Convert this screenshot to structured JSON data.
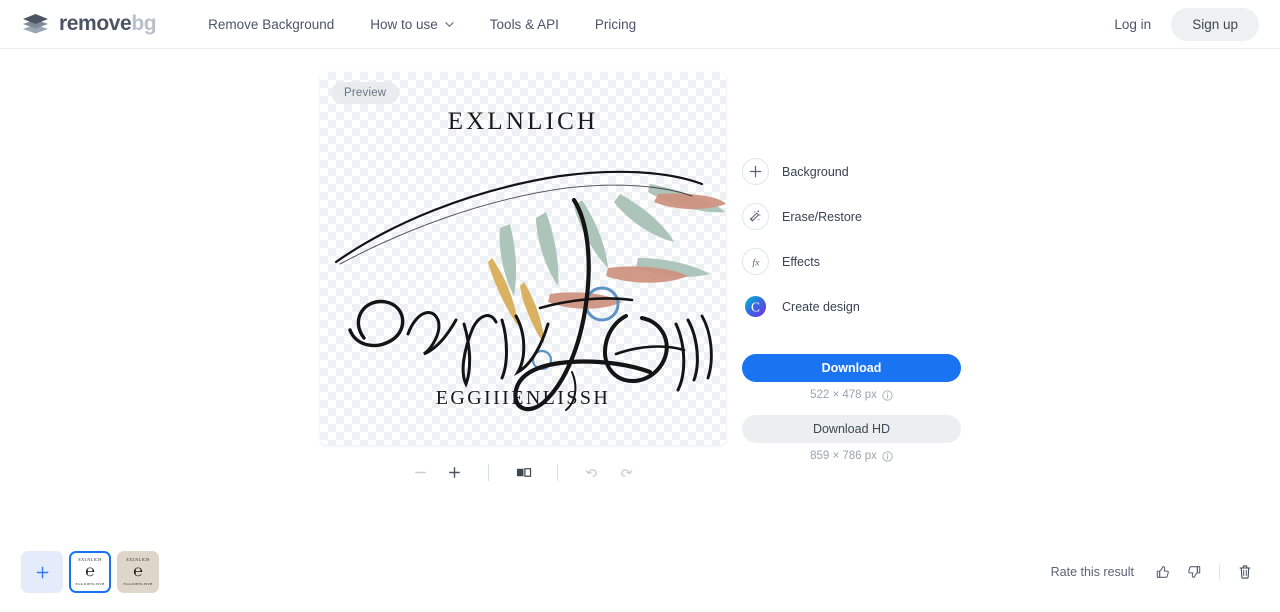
{
  "header": {
    "logo": {
      "icon": "layers-diamond-icon",
      "text_primary": "remove",
      "text_secondary": "bg"
    },
    "nav": [
      {
        "label": "Remove Background",
        "name": "nav-remove-background",
        "chevron": false
      },
      {
        "label": "How to use",
        "name": "nav-how-to-use",
        "chevron": true
      },
      {
        "label": "Tools & API",
        "name": "nav-tools-api",
        "chevron": false
      },
      {
        "label": "Pricing",
        "name": "nav-pricing",
        "chevron": false
      }
    ],
    "login_label": "Log in",
    "signup_label": "Sign up"
  },
  "canvas": {
    "preview_badge": "Preview",
    "artwork": {
      "title_text": "EXLNLICH",
      "subtitle_text": "EGGIIIENLISSH",
      "description": "ornate calligraphic script logo with botanical leaf flourishes",
      "colors": {
        "ink": "#1a1a1a",
        "leaf_sage": "#9db9ae",
        "leaf_terracotta": "#c98b75",
        "leaf_gold": "#d6a94e",
        "accent_blue": "#3e7fbf"
      }
    }
  },
  "toolbar": {
    "zoom_out": {
      "label": "−",
      "name": "zoom-out-button",
      "disabled": true
    },
    "zoom_in": {
      "label": "+",
      "name": "zoom-in-button",
      "disabled": false
    },
    "compare": {
      "name": "compare-split-toggle",
      "disabled": false
    },
    "undo": {
      "name": "undo-button",
      "disabled": true
    },
    "redo": {
      "name": "redo-button",
      "disabled": true
    }
  },
  "panel": {
    "tools": [
      {
        "label": "Background",
        "icon": "plus-icon",
        "name": "tool-background"
      },
      {
        "label": "Erase/Restore",
        "icon": "magic-brush-icon",
        "name": "tool-erase-restore"
      },
      {
        "label": "Effects",
        "icon": "fx-icon",
        "name": "tool-effects"
      },
      {
        "label": "Create design",
        "icon": "canva-logo-icon",
        "name": "tool-create-design"
      }
    ],
    "download": {
      "primary_label": "Download",
      "primary_size": "522 × 478 px",
      "secondary_label": "Download HD",
      "secondary_size": "859 × 786 px",
      "info_icon": "info-circle-icon"
    }
  },
  "thumbnails": {
    "add_label": "+",
    "items": [
      {
        "name": "thumbnail-result-1",
        "selected": true,
        "background": "#ffffff",
        "title": "EXLNLICH",
        "subtitle": "EGGIIIENLISSH"
      },
      {
        "name": "thumbnail-result-2",
        "selected": false,
        "background": "#ded7c9",
        "title": "EXLNLICH",
        "subtitle": "EGGIIIENLISSH"
      }
    ]
  },
  "rate": {
    "label": "Rate this result",
    "thumbs_up": "thumbs-up-icon",
    "thumbs_down": "thumbs-down-icon",
    "delete": "trash-icon"
  },
  "colors": {
    "accent_blue": "#1a73f0",
    "text_dark": "#384250",
    "text_muted": "#9aa3ad",
    "border": "#eceff1"
  }
}
